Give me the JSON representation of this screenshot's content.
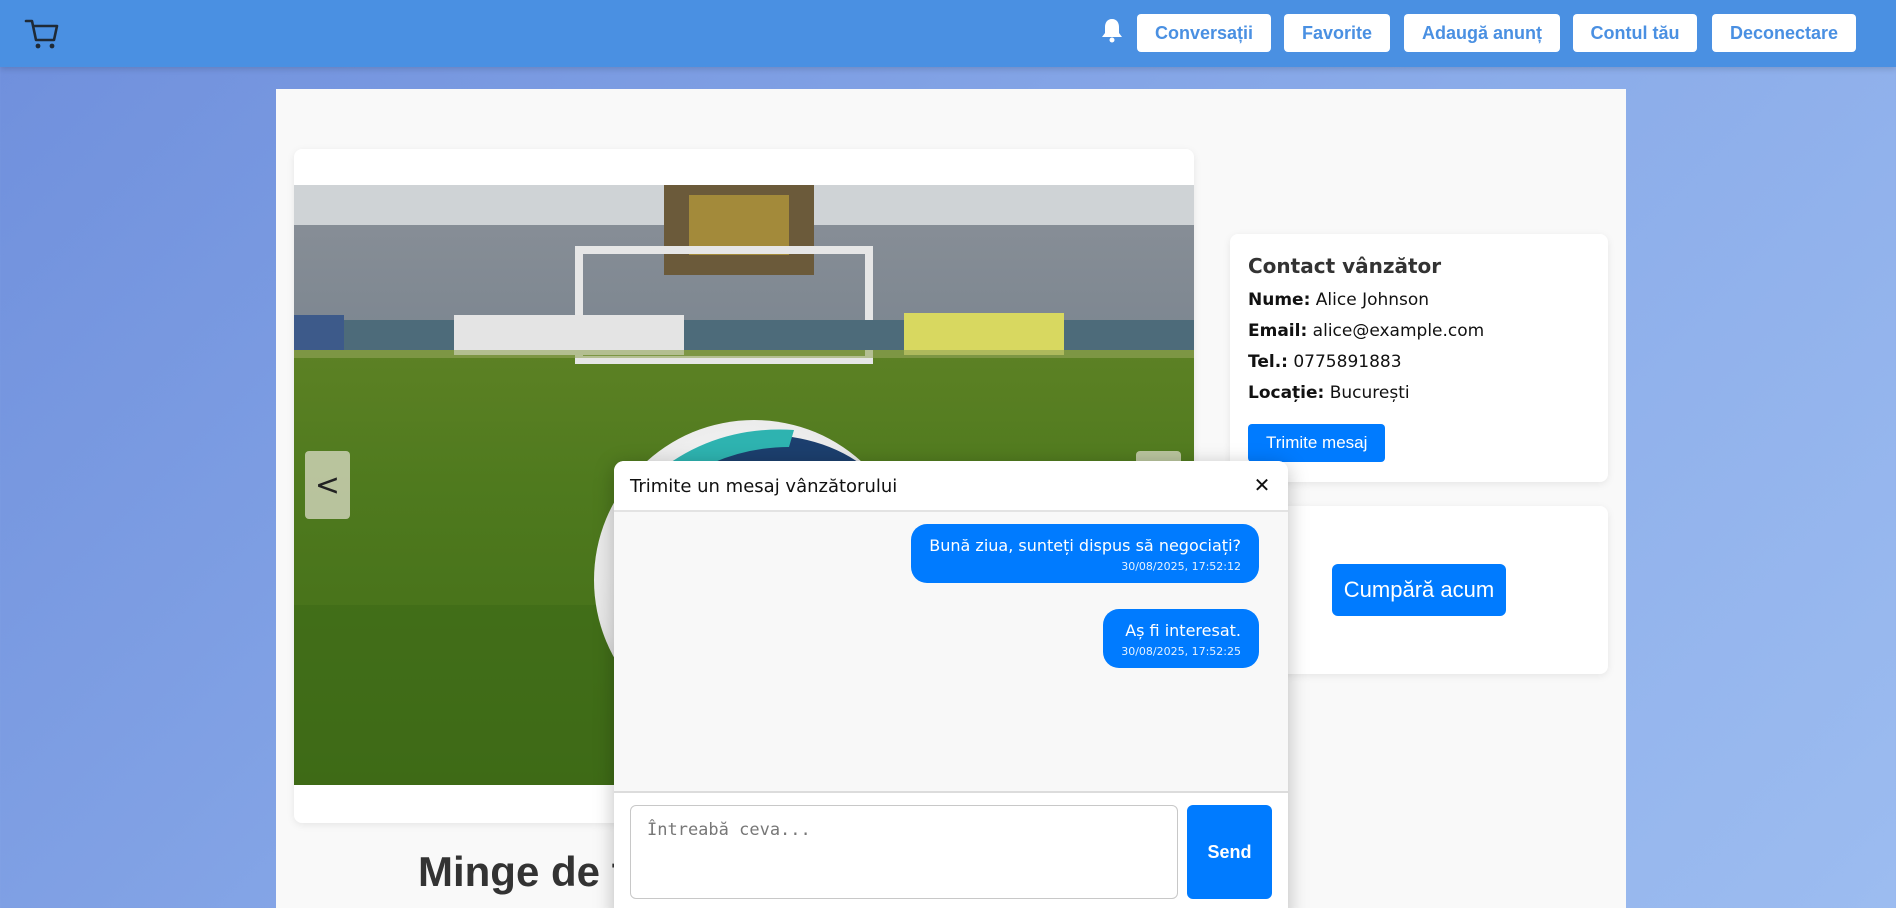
{
  "navbar": {
    "buttons": [
      "Conversații",
      "Favorite",
      "Adaugă anunț",
      "Contul tău",
      "Deconectare"
    ],
    "icons": {
      "logo": "cart-icon",
      "notifications": "bell-icon"
    },
    "colors": {
      "bar": "#4a90e2",
      "button_text": "#4a90e2"
    }
  },
  "gallery": {
    "prev_label": "<",
    "image": "football-on-grass-photo"
  },
  "product": {
    "title_visible": "Minge de f"
  },
  "contact": {
    "title": "Contact vânzător",
    "name_label": "Nume:",
    "name": "Alice Johnson",
    "email_label": "Email:",
    "email": "alice@example.com",
    "phone_label": "Tel.:",
    "phone": "0775891883",
    "location_label": "Locație:",
    "location": "București",
    "send_button": "Trimite mesaj"
  },
  "buy": {
    "button": "Cumpără acum"
  },
  "chat": {
    "title": "Trimite un mesaj vânzătorului",
    "close": "✕",
    "messages": [
      {
        "text": "Bună ziua, sunteți dispus să negociați?",
        "time": "30/08/2025, 17:52:12"
      },
      {
        "text": "Aș fi interesat.",
        "time": "30/08/2025, 17:52:25"
      }
    ],
    "input_placeholder": "Întreabă ceva...",
    "send_label": "Send"
  },
  "accent_color": "#007bff"
}
